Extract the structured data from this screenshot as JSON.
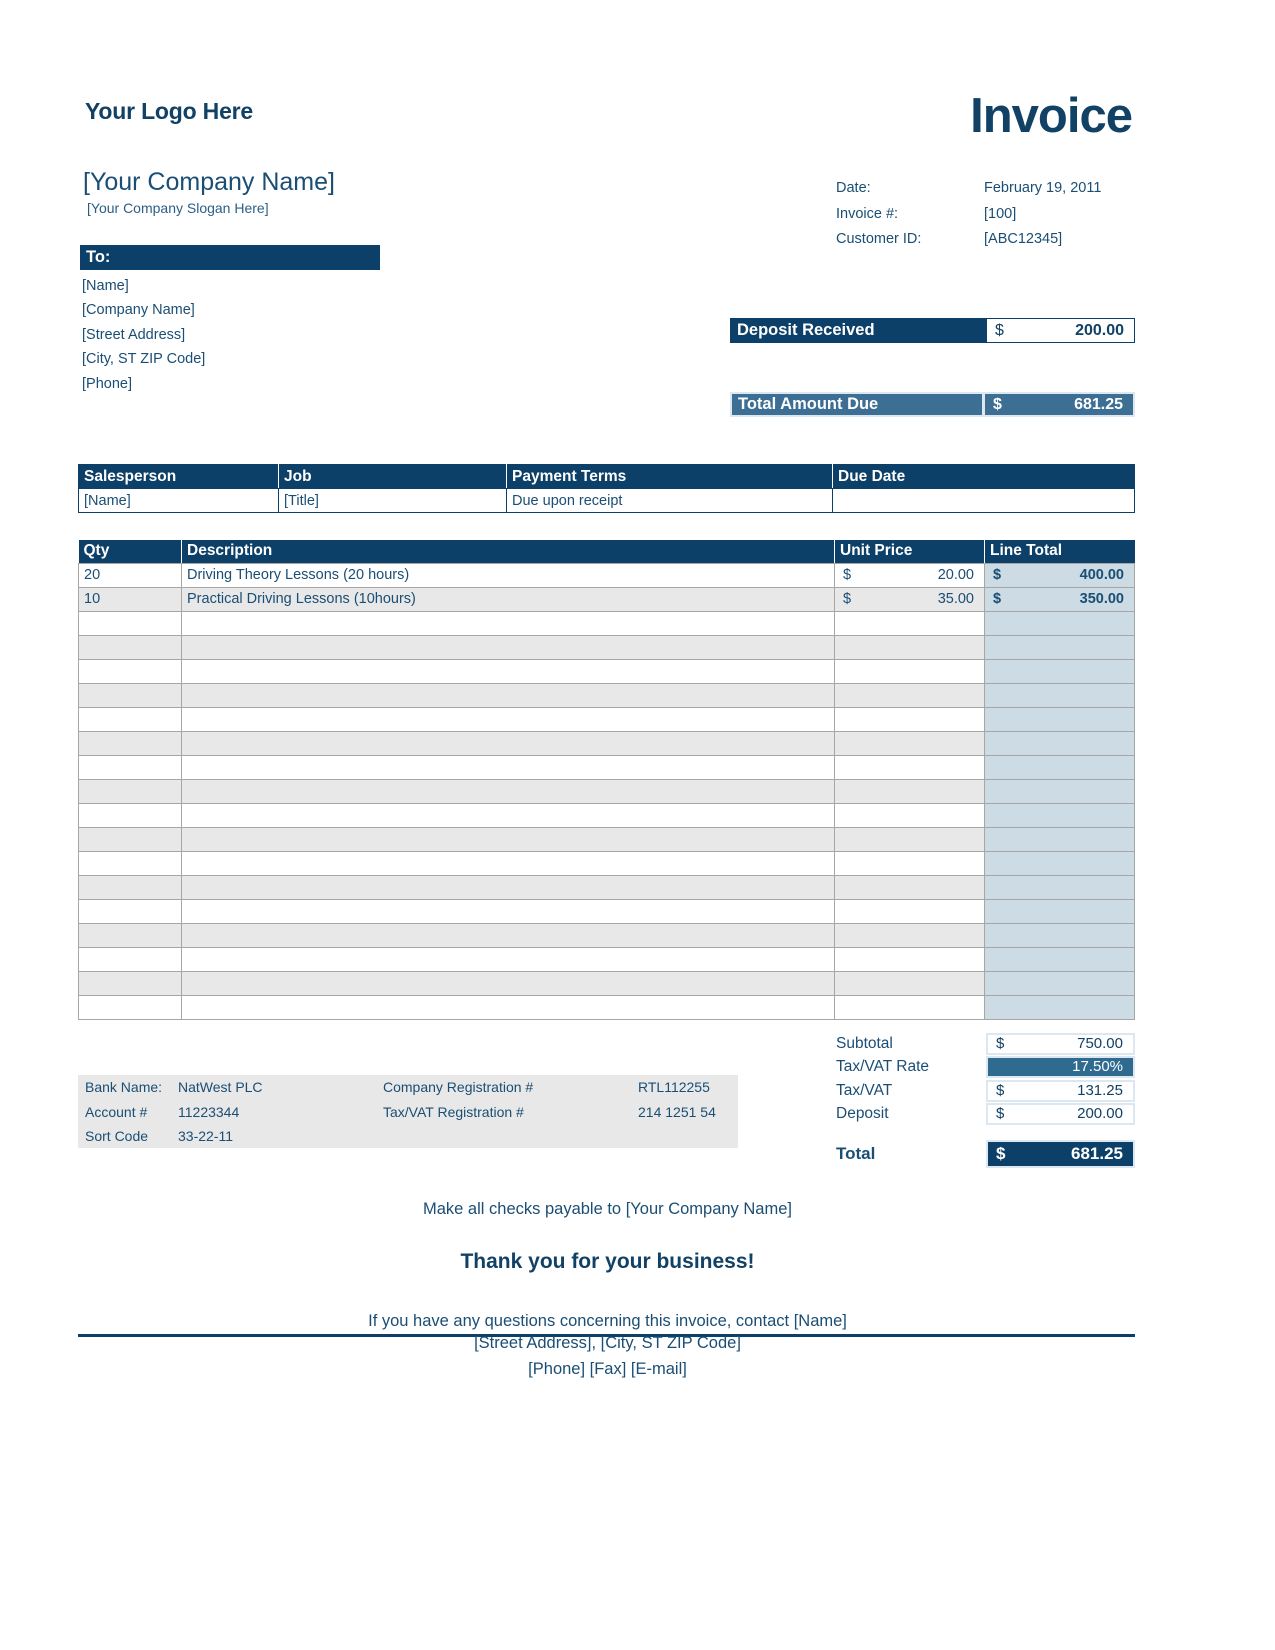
{
  "header": {
    "logo_text": "Your Logo Here",
    "title": "Invoice",
    "company_name": "[Your Company Name]",
    "company_slogan": "[Your Company Slogan Here]"
  },
  "meta": {
    "date_label": "Date:",
    "date_value": "February 19, 2011",
    "invoice_no_label": "Invoice #:",
    "invoice_no_value": "[100]",
    "customer_id_label": "Customer ID:",
    "customer_id_value": "[ABC12345]"
  },
  "bill_to": {
    "heading": "To:",
    "lines": [
      "[Name]",
      "[Company Name]",
      "[Street Address]",
      "[City, ST  ZIP Code]",
      "[Phone]"
    ]
  },
  "deposit_received": {
    "label": "Deposit Received",
    "currency": "$",
    "amount": "200.00"
  },
  "total_amount_due": {
    "label": "Total Amount Due",
    "currency": "$",
    "amount": "681.25"
  },
  "salesperson_table": {
    "headers": [
      "Salesperson",
      "Job",
      "Payment Terms",
      "Due Date"
    ],
    "row": [
      "[Name]",
      "[Title]",
      "Due upon receipt",
      ""
    ]
  },
  "line_items": {
    "headers": [
      "Qty",
      "Description",
      "Unit Price",
      "Line Total"
    ],
    "currency": "$",
    "rows": [
      {
        "qty": "20",
        "description": "Driving Theory Lessons (20 hours)",
        "unit_price": "20.00",
        "line_total": "400.00"
      },
      {
        "qty": "10",
        "description": "Practical Driving Lessons (10hours)",
        "unit_price": "35.00",
        "line_total": "350.00"
      },
      {
        "qty": "",
        "description": "",
        "unit_price": "",
        "line_total": ""
      },
      {
        "qty": "",
        "description": "",
        "unit_price": "",
        "line_total": ""
      },
      {
        "qty": "",
        "description": "",
        "unit_price": "",
        "line_total": ""
      },
      {
        "qty": "",
        "description": "",
        "unit_price": "",
        "line_total": ""
      },
      {
        "qty": "",
        "description": "",
        "unit_price": "",
        "line_total": ""
      },
      {
        "qty": "",
        "description": "",
        "unit_price": "",
        "line_total": ""
      },
      {
        "qty": "",
        "description": "",
        "unit_price": "",
        "line_total": ""
      },
      {
        "qty": "",
        "description": "",
        "unit_price": "",
        "line_total": ""
      },
      {
        "qty": "",
        "description": "",
        "unit_price": "",
        "line_total": ""
      },
      {
        "qty": "",
        "description": "",
        "unit_price": "",
        "line_total": ""
      },
      {
        "qty": "",
        "description": "",
        "unit_price": "",
        "line_total": ""
      },
      {
        "qty": "",
        "description": "",
        "unit_price": "",
        "line_total": ""
      },
      {
        "qty": "",
        "description": "",
        "unit_price": "",
        "line_total": ""
      },
      {
        "qty": "",
        "description": "",
        "unit_price": "",
        "line_total": ""
      },
      {
        "qty": "",
        "description": "",
        "unit_price": "",
        "line_total": ""
      },
      {
        "qty": "",
        "description": "",
        "unit_price": "",
        "line_total": ""
      },
      {
        "qty": "",
        "description": "",
        "unit_price": "",
        "line_total": ""
      }
    ]
  },
  "totals": {
    "subtotal_label": "Subtotal",
    "subtotal_currency": "$",
    "subtotal_value": "750.00",
    "tax_rate_label": "Tax/VAT Rate",
    "tax_rate_value": "17.50%",
    "tax_label": "Tax/VAT",
    "tax_currency": "$",
    "tax_value": "131.25",
    "deposit_label": "Deposit",
    "deposit_currency": "$",
    "deposit_value": "200.00",
    "total_label": "Total",
    "total_currency": "$",
    "total_value": "681.25"
  },
  "bank": {
    "bank_name_label": "Bank Name:",
    "bank_name_value": "NatWest PLC",
    "account_label": "Account #",
    "account_value": "11223344",
    "sort_code_label": "Sort Code",
    "sort_code_value": "33-22-11",
    "company_reg_label": "Company Registration #",
    "company_reg_value": "RTL112255",
    "vat_reg_label": "Tax/VAT Registration #",
    "vat_reg_value": "214 1251 54"
  },
  "footer": {
    "payable_to": "Make all checks payable to [Your Company Name]",
    "thanks": "Thank you for your business!",
    "questions": "If you have any questions concerning this invoice, contact [Name]",
    "address_line_1": "[Street Address], [City, ST  ZIP Code]",
    "address_line_2": "[Phone]  [Fax]  [E-mail]"
  }
}
